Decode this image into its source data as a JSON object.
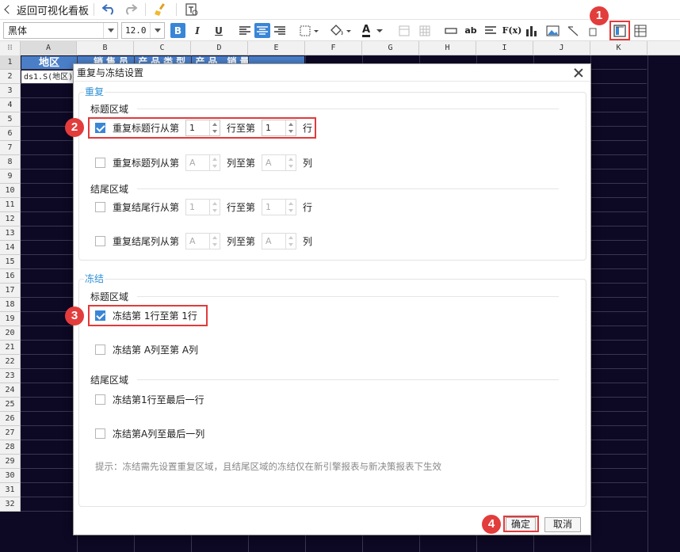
{
  "topbar": {
    "back_label": "返回可视化看板"
  },
  "format": {
    "font": "黑体",
    "size": "12.0",
    "bold": "B",
    "italic": "I",
    "underline": "U",
    "font_color": "A",
    "fx": "F(x)",
    "ab": "ab"
  },
  "sheet": {
    "columns": [
      "A",
      "B",
      "C",
      "D",
      "E",
      "F",
      "G",
      "H",
      "I",
      "J",
      "K"
    ],
    "rows": [
      "1",
      "2",
      "3",
      "4",
      "5",
      "6",
      "7",
      "8",
      "9",
      "10",
      "11",
      "12",
      "13",
      "14",
      "15",
      "16",
      "17",
      "18",
      "19",
      "20",
      "21",
      "22",
      "23",
      "24",
      "25",
      "26",
      "27",
      "28",
      "29",
      "30",
      "31",
      "32"
    ],
    "a1": "地区",
    "b1": "销售员 产品类型 产品 销量",
    "a2": "ds1.S(地区)"
  },
  "dialog": {
    "title": "重复与冻结设置",
    "repeat": {
      "section": "重复",
      "title_area": "标题区域",
      "footer_area": "结尾区域",
      "title_row": {
        "label": "重复标题行从第",
        "from": "1",
        "to_label": "行至第",
        "to": "1",
        "unit": "行",
        "checked": true
      },
      "title_col": {
        "label": "重复标题列从第",
        "from": "A",
        "to_label": "列至第",
        "to": "A",
        "unit": "列",
        "checked": false
      },
      "footer_row": {
        "label": "重复结尾行从第",
        "from": "1",
        "to_label": "行至第",
        "to": "1",
        "unit": "行",
        "checked": false
      },
      "footer_col": {
        "label": "重复结尾列从第",
        "from": "A",
        "to_label": "列至第",
        "to": "A",
        "unit": "列",
        "checked": false
      }
    },
    "freeze": {
      "section": "冻结",
      "title_area": "标题区域",
      "footer_area": "结尾区域",
      "row": {
        "label": "冻结第 1行至第 1行",
        "checked": true
      },
      "col": {
        "label": "冻结第 A列至第 A列",
        "checked": false
      },
      "footer_row": {
        "label": "冻结第1行至最后一行",
        "checked": false
      },
      "footer_col": {
        "label": "冻结第A列至最后一列",
        "checked": false
      }
    },
    "hint": "提示：冻结需先设置重复区域，且结尾区域的冻结仅在新引擎报表与新决策报表下生效",
    "ok": "确定",
    "cancel": "取消"
  },
  "annotations": [
    "1",
    "2",
    "3",
    "4"
  ],
  "colors": {
    "accent": "#3a86d6",
    "header_cell": "#4a7fc8",
    "marker": "#e23a3a",
    "sheet_bg": "#0d0824"
  }
}
